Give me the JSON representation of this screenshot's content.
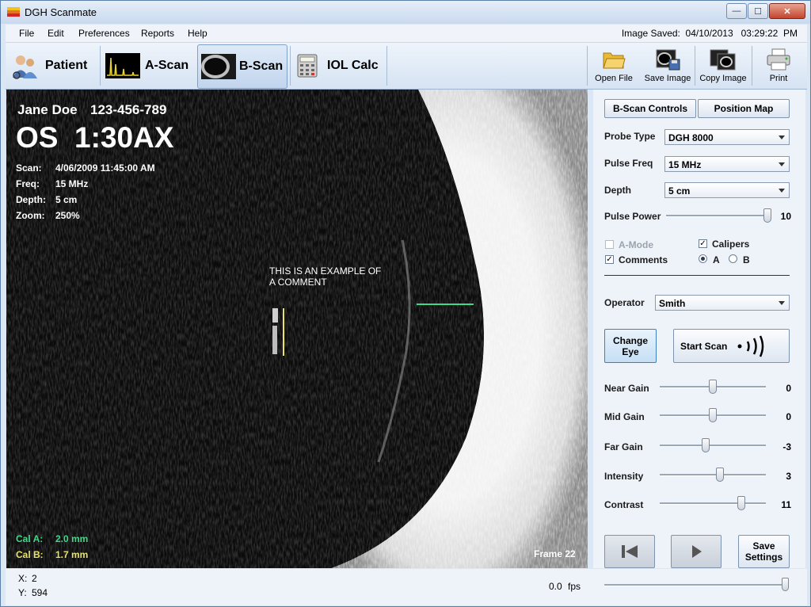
{
  "window": {
    "title": "DGH Scanmate",
    "minimize_glyph": "—",
    "maximize_glyph": "☐",
    "close_glyph": "✕"
  },
  "menu": {
    "items": [
      "File",
      "Edit",
      "Preferences",
      "Reports",
      "Help"
    ],
    "image_saved": "Image Saved:  04/10/2013   03:29:22  PM"
  },
  "toolbar": {
    "tabs": [
      {
        "label": "Patient",
        "icon": "patient-icon"
      },
      {
        "label": "A-Scan",
        "icon": "a-scan-icon"
      },
      {
        "label": "B-Scan",
        "icon": "b-scan-icon",
        "active": true
      },
      {
        "label": "IOL Calc",
        "icon": "calculator-icon"
      }
    ],
    "buttons": [
      {
        "label": "Open File",
        "icon": "folder-icon"
      },
      {
        "label": "Save Image",
        "icon": "save-image-icon"
      },
      {
        "label": "Copy Image",
        "icon": "copy-image-icon"
      },
      {
        "label": "Print",
        "icon": "printer-icon"
      }
    ]
  },
  "scan": {
    "patient_name": "Jane Doe",
    "patient_id": "123-456-789",
    "eye_position": "OS  1:30AX",
    "info": [
      {
        "label": "Scan:",
        "value": "4/06/2009 11:45:00 AM"
      },
      {
        "label": "Freq:",
        "value": "15 MHz"
      },
      {
        "label": "Depth:",
        "value": "5 cm"
      },
      {
        "label": "Zoom:",
        "value": "250%"
      }
    ],
    "comment": [
      "THIS IS AN EXAMPLE OF",
      "A COMMENT"
    ],
    "cal_a_label": "Cal A:",
    "cal_a_value": "2.0 mm",
    "cal_b_label": "Cal B:",
    "cal_b_value": "1.7 mm",
    "frame": "Frame 22",
    "colors": {
      "cal_a": "#3fd98a",
      "cal_b": "#e8e36b"
    }
  },
  "panel": {
    "tabs": [
      "B-Scan Controls",
      "Position Map"
    ],
    "probe_type": {
      "label": "Probe Type",
      "value": "DGH 8000"
    },
    "pulse_freq": {
      "label": "Pulse Freq",
      "value": "15 MHz"
    },
    "depth": {
      "label": "Depth",
      "value": "5 cm"
    },
    "pulse_power": {
      "label": "Pulse Power",
      "value": "10"
    },
    "checkboxes": {
      "a_mode": {
        "label": "A-Mode",
        "checked": false
      },
      "comments": {
        "label": "Comments",
        "checked": true
      },
      "calipers": {
        "label": "Calipers",
        "checked": true
      }
    },
    "radios": {
      "a": "A",
      "b": "B",
      "selected": "A"
    },
    "operator": {
      "label": "Operator",
      "value": "Smith"
    },
    "change_eye": [
      "Change",
      "Eye"
    ],
    "start_scan": "Start Scan",
    "sliders": [
      {
        "label": "Near Gain",
        "value": "0",
        "fraction": 0.5
      },
      {
        "label": "Mid Gain",
        "value": "0",
        "fraction": 0.5
      },
      {
        "label": "Far Gain",
        "value": "-3",
        "fraction": 0.43
      },
      {
        "label": "Intensity",
        "value": "3",
        "fraction": 0.57
      },
      {
        "label": "Contrast",
        "value": "11",
        "fraction": 0.77
      }
    ],
    "save_settings": [
      "Save",
      "Settings"
    ]
  },
  "status": {
    "x_label": "X:",
    "x_value": "2",
    "y_label": "Y:",
    "y_value": "594",
    "fps_value": "0.0",
    "fps_label": "fps"
  }
}
